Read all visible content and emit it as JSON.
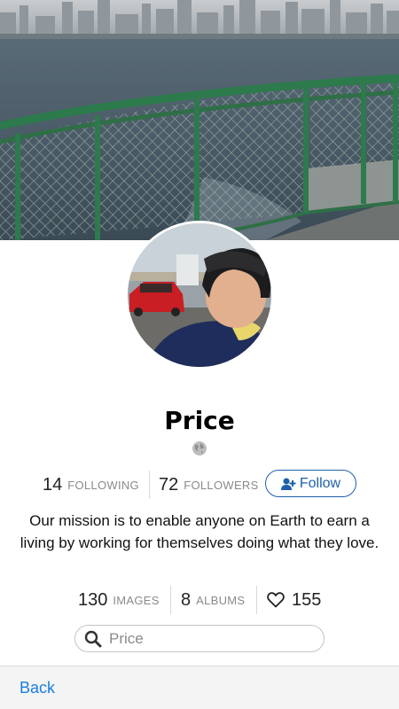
{
  "profile": {
    "name": "Price",
    "following_count": "14",
    "following_label": "FOLLOWING",
    "followers_count": "72",
    "followers_label": "FOLLOWERS",
    "follow_label": "Follow",
    "bio": "Our mission is to enable anyone on Earth to earn a living by working for themselves doing what they love.",
    "images_count": "130",
    "images_label": "IMAGES",
    "albums_count": "8",
    "albums_label": "ALBUMS",
    "likes_count": "155"
  },
  "search": {
    "placeholder": "Price"
  },
  "bottom_bar": {
    "back_label": "Back"
  },
  "icons": {
    "globe": "globe-icon",
    "follow": "add-user-icon",
    "heart": "heart-icon",
    "search": "search-icon"
  },
  "colors": {
    "accent": "#1e5fa8",
    "link": "#1a7ee0",
    "muted": "#8a8a8a"
  }
}
